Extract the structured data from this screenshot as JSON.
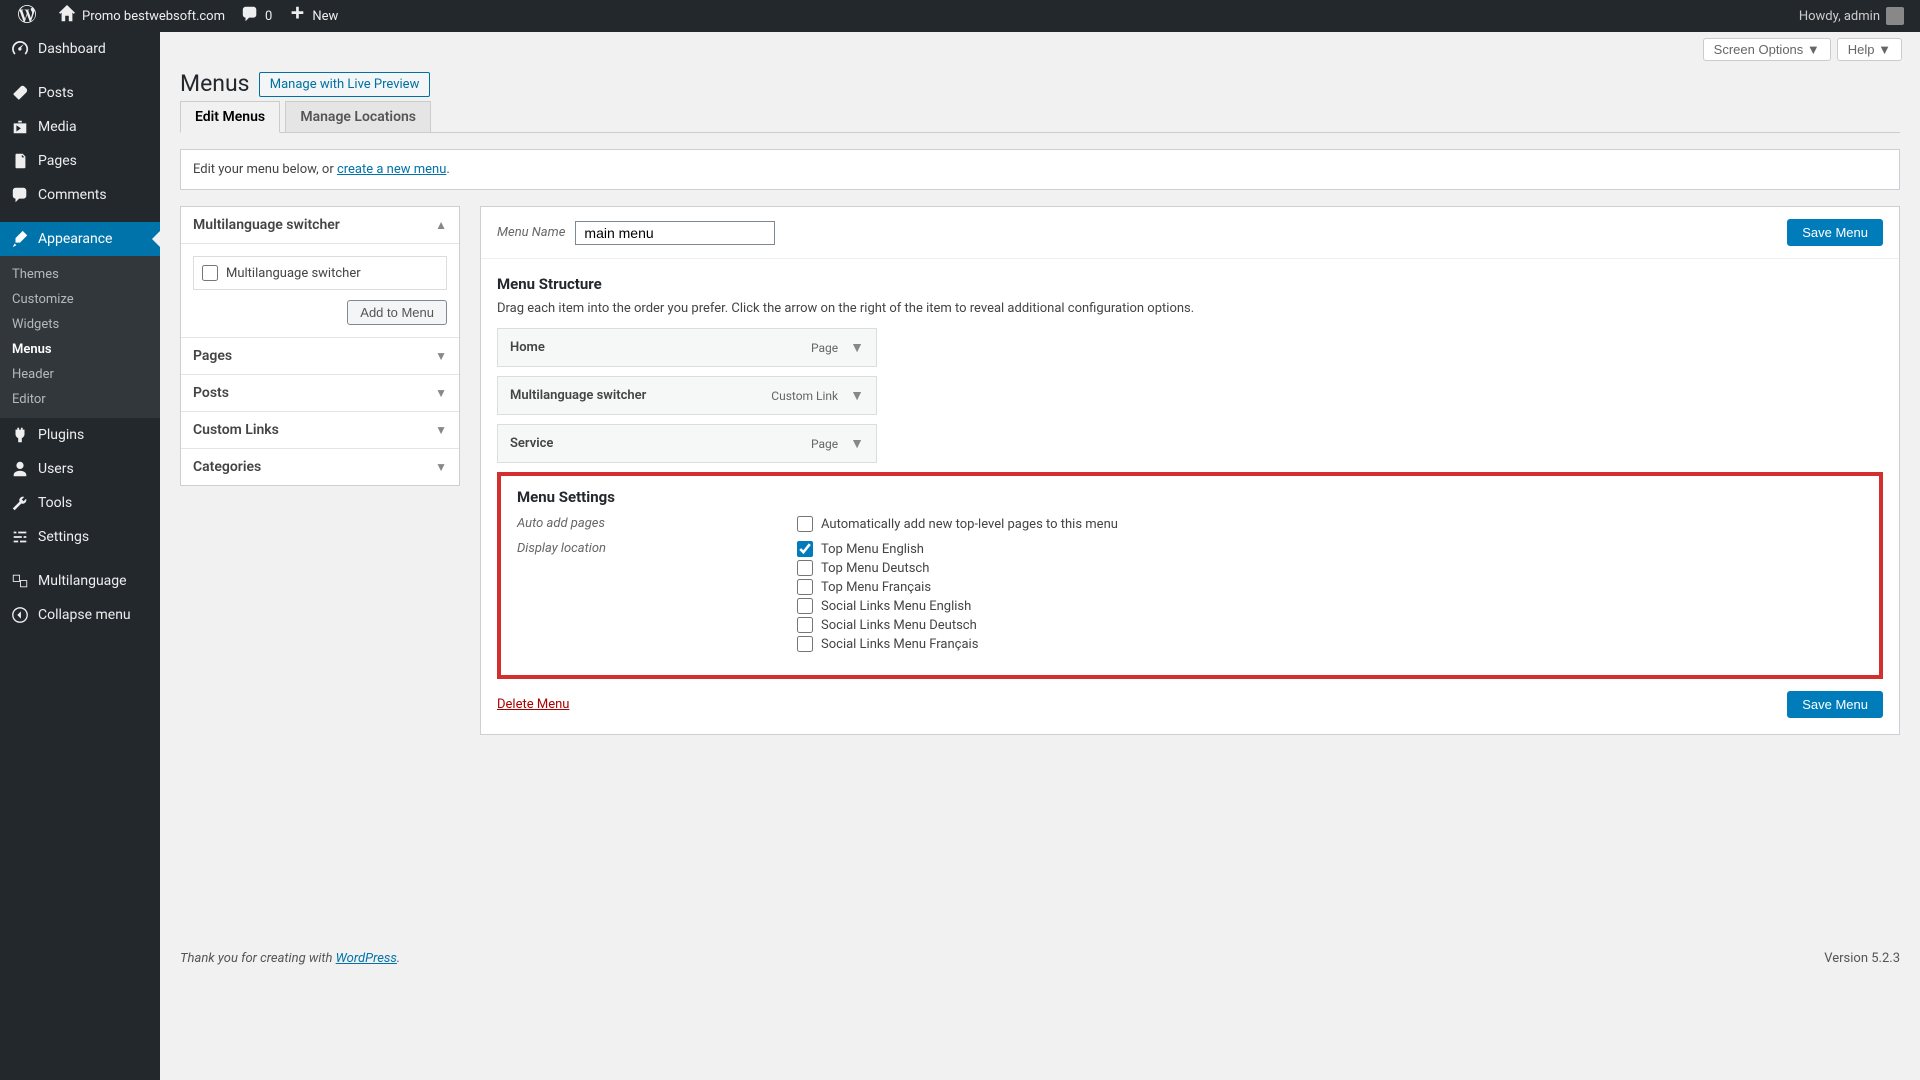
{
  "admin_bar": {
    "site_name": "Promo bestwebsoft.com",
    "comment_count": "0",
    "new_label": "New",
    "howdy": "Howdy, admin"
  },
  "sidebar": {
    "dashboard": "Dashboard",
    "posts": "Posts",
    "media": "Media",
    "pages": "Pages",
    "comments": "Comments",
    "appearance": "Appearance",
    "themes": "Themes",
    "customize": "Customize",
    "widgets": "Widgets",
    "menus": "Menus",
    "header": "Header",
    "editor": "Editor",
    "plugins": "Plugins",
    "users": "Users",
    "tools": "Tools",
    "settings": "Settings",
    "multilanguage": "Multilanguage",
    "collapse": "Collapse menu"
  },
  "screen_options": "Screen Options",
  "help": "Help",
  "page_title": "Menus",
  "manage_live_preview": "Manage with Live Preview",
  "tabs": {
    "edit_menus": "Edit Menus",
    "manage_locations": "Manage Locations"
  },
  "notice": {
    "prefix": "Edit your menu below, or ",
    "link": "create a new menu",
    "suffix": "."
  },
  "accordion": {
    "multi_switcher": "Multilanguage switcher",
    "multi_switcher_checkbox": "Multilanguage switcher",
    "add_to_menu": "Add to Menu",
    "pages": "Pages",
    "posts": "Posts",
    "custom_links": "Custom Links",
    "categories": "Categories"
  },
  "menu_name_label": "Menu Name",
  "menu_name_value": "main menu",
  "save_menu": "Save Menu",
  "menu_structure": {
    "heading": "Menu Structure",
    "description": "Drag each item into the order you prefer. Click the arrow on the right of the item to reveal additional configuration options.",
    "items": [
      {
        "title": "Home",
        "type": "Page"
      },
      {
        "title": "Multilanguage switcher",
        "type": "Custom Link"
      },
      {
        "title": "Service",
        "type": "Page"
      }
    ]
  },
  "menu_settings": {
    "heading": "Menu Settings",
    "auto_add_label": "Auto add pages",
    "auto_add_checkbox": "Automatically add new top-level pages to this menu",
    "display_location_label": "Display location",
    "locations": [
      {
        "label": "Top Menu English",
        "checked": true
      },
      {
        "label": "Top Menu Deutsch",
        "checked": false
      },
      {
        "label": "Top Menu Français",
        "checked": false
      },
      {
        "label": "Social Links Menu English",
        "checked": false
      },
      {
        "label": "Social Links Menu Deutsch",
        "checked": false
      },
      {
        "label": "Social Links Menu Français",
        "checked": false
      }
    ]
  },
  "delete_menu": "Delete Menu",
  "footer": {
    "thanks_prefix": "Thank you for creating with ",
    "wp": "WordPress",
    "suffix": ".",
    "version": "Version 5.2.3"
  }
}
